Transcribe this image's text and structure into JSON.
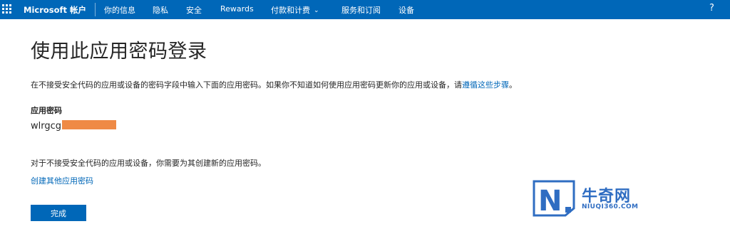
{
  "header": {
    "brand": "Microsoft 帐户",
    "nav": [
      {
        "label": "你的信息"
      },
      {
        "label": "隐私"
      },
      {
        "label": "安全"
      },
      {
        "label": "Rewards"
      },
      {
        "label": "付款和计费"
      },
      {
        "label": "服务和订阅"
      },
      {
        "label": "设备"
      }
    ],
    "help": "?"
  },
  "main": {
    "title": "使用此应用密码登录",
    "intro_text": "在不接受安全代码的应用或设备的密码字段中输入下面的应用密码。如果你不知道如何使用应用密码更新你的应用或设备，请",
    "intro_link": "遵循这些步骤",
    "intro_end": "。",
    "password_label": "应用密码",
    "password_value": "wlrgcg",
    "note": "对于不接受安全代码的应用或设备，你需要为其创建新的应用密码。",
    "create_link": "创建其他应用密码",
    "done_button": "完成"
  },
  "watermark": {
    "name": "牛奇网",
    "domain": "NIUQI360.COM"
  },
  "colors": {
    "brand_blue": "#0067b8",
    "redaction": "#ef8a45",
    "watermark_blue": "#2f6dc2"
  }
}
